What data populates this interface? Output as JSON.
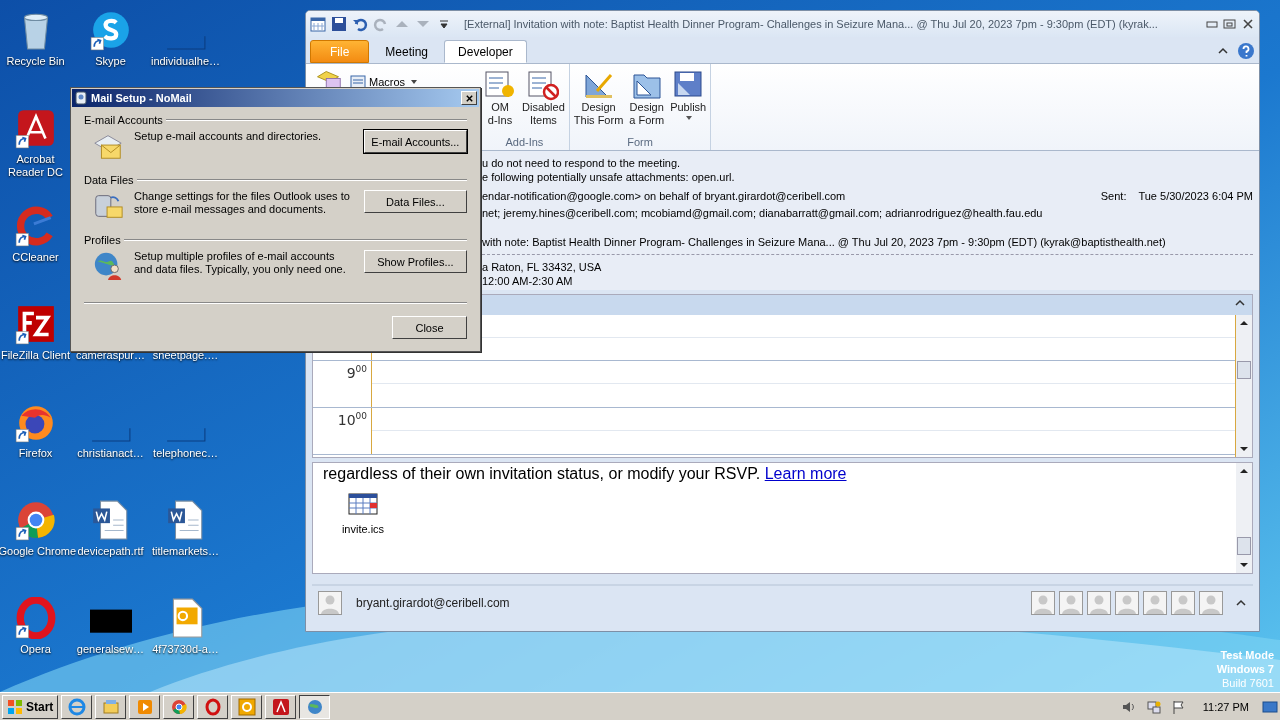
{
  "desktop_columns": [
    {
      "icons": [
        {
          "label": "Recycle Bin",
          "kind": "recycle",
          "shortcut": false
        },
        {
          "label": "Acrobat Reader DC",
          "kind": "acrobat",
          "shortcut": true
        },
        {
          "label": "CCleaner",
          "kind": "ccleaner",
          "shortcut": true
        },
        {
          "label": "FileZilla Client",
          "kind": "filezilla",
          "shortcut": true
        },
        {
          "label": "Firefox",
          "kind": "firefox",
          "shortcut": true
        },
        {
          "label": "Google Chrome",
          "kind": "chrome",
          "shortcut": true
        },
        {
          "label": "Opera",
          "kind": "opera",
          "shortcut": true
        }
      ]
    },
    {
      "icons": [
        {
          "label": "Skype",
          "kind": "skype",
          "shortcut": true
        },
        {
          "label": "cameraspur…",
          "kind": "covered"
        },
        {
          "label": "christianact…",
          "kind": "blank",
          "shortcut": false
        },
        {
          "label": "devicepath.rtf",
          "kind": "word",
          "shortcut": false
        },
        {
          "label": "generalsew…",
          "kind": "black",
          "shortcut": false
        }
      ]
    },
    {
      "icons": [
        {
          "label": "individualhe…",
          "kind": "blank",
          "shortcut": false
        },
        {
          "label": "sheetpage.…",
          "kind": "covered"
        },
        {
          "label": "telephonec…",
          "kind": "blank",
          "shortcut": false
        },
        {
          "label": "titlemarkets…",
          "kind": "word",
          "shortcut": false
        },
        {
          "label": "4f73730d-a…",
          "kind": "outlookdoc",
          "shortcut": false
        }
      ]
    }
  ],
  "outlook": {
    "title": "[External] Invitation with note: Baptist Health Dinner Program- Challenges in Seizure Mana... @ Thu Jul 20, 2023 7pm - 9:30pm (EDT) (kyrak...",
    "tabs": [
      {
        "label": "File",
        "kind": "file",
        "selected": false
      },
      {
        "label": "Meeting",
        "kind": "tab",
        "selected": false
      },
      {
        "label": "Developer",
        "kind": "tab",
        "selected": true
      }
    ],
    "macros": "Macros",
    "groups": [
      {
        "label": "Add-Ins",
        "buttons": [
          {
            "label": "OM\nd-Ins",
            "kind": "com"
          },
          {
            "label": "Disabled\nItems",
            "kind": "disabled"
          }
        ]
      },
      {
        "label": "Form",
        "buttons": [
          {
            "label": "Design\nThis Form",
            "kind": "design"
          },
          {
            "label": "Design\na Form",
            "kind": "designform"
          },
          {
            "label": "Publish",
            "kind": "publish"
          }
        ]
      }
    ],
    "notices": [
      "u do not need to respond to the meeting.",
      "e following potentially unsafe attachments: open.url."
    ],
    "from": "endar-notification@google.com> on behalf of bryant.girardot@ceribell.com",
    "sent_label": "Sent:",
    "sent": "Tue 5/30/2023 6:04 PM",
    "to": "net; jeremy.hines@ceribell.com; mcobiamd@gmail.com; dianabarratt@gmail.com; adrianrodriguez@health.fau.edu",
    "subject": "with note: Baptist Health Dinner Program- Challenges in Seizure Mana... @ Thu Jul 20, 2023 7pm - 9:30pm (EDT) (kyrak@baptisthealth.net)",
    "location": "a Raton, FL 33432, USA",
    "when": "12:00 AM-2:30 AM",
    "times": [
      {
        "hour": "9",
        "min": "00"
      },
      {
        "hour": "10",
        "min": "00"
      }
    ],
    "body": "regardless of their own invitation status, or modify your RSVP.",
    "link": "Learn more",
    "attachment": "invite.ics",
    "sender": "bryant.girardot@ceribell.com",
    "people": [
      {
        "kind": "person"
      },
      {
        "kind": "person"
      },
      {
        "kind": "person"
      },
      {
        "kind": "person"
      },
      {
        "kind": "person"
      },
      {
        "kind": "person"
      },
      {
        "kind": "person"
      }
    ]
  },
  "dialog": {
    "title": "Mail Setup - NoMail",
    "sections": [
      {
        "heading": "E-mail Accounts",
        "text": "Setup e-mail accounts and directories.",
        "button": "E-mail Accounts...",
        "kind": "accounts",
        "default": true
      },
      {
        "heading": "Data Files",
        "text": "Change settings for the files Outlook uses to store e-mail messages and documents.",
        "button": "Data Files...",
        "kind": "datafiles",
        "default": false
      },
      {
        "heading": "Profiles",
        "text": "Setup multiple profiles of e-mail accounts and data files. Typically, you only need one.",
        "button": "Show Profiles...",
        "kind": "profiles",
        "default": false
      }
    ],
    "close": "Close"
  },
  "test_mode": [
    "Test Mode",
    "Windows 7",
    "Build 7601"
  ],
  "taskbar": {
    "start": "Start",
    "apps": [
      {
        "kind": "ie",
        "active": false
      },
      {
        "kind": "explorer",
        "active": false
      },
      {
        "kind": "media",
        "active": false
      },
      {
        "kind": "chrome",
        "active": false
      },
      {
        "kind": "opera",
        "active": false
      },
      {
        "kind": "outlook",
        "active": false
      },
      {
        "kind": "acrobat",
        "active": false
      },
      {
        "kind": "mailsetup",
        "active": true
      }
    ],
    "clock": "11:27 PM"
  }
}
